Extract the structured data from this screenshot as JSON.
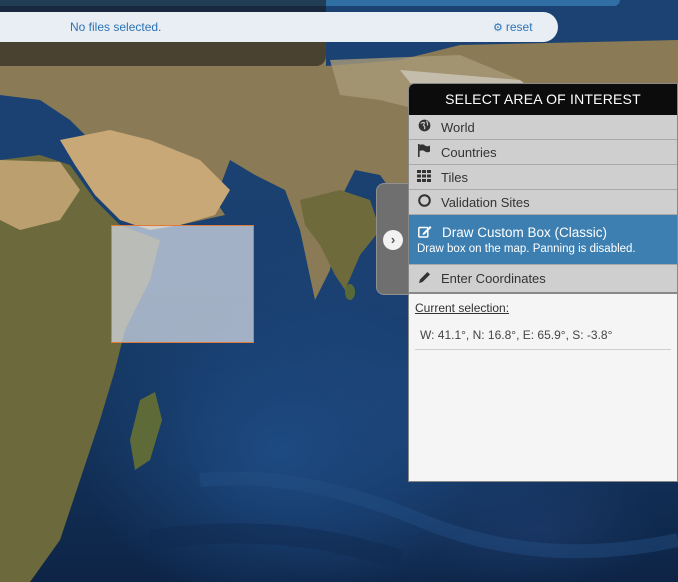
{
  "file_bar": {
    "status": "No files selected.",
    "reset_label": "reset",
    "reset_icon": "gears-icon"
  },
  "panel": {
    "title": "SELECT AREA OF INTEREST",
    "toggle_icon": "chevron-right-circle-icon",
    "items": [
      {
        "label": "World",
        "icon": "globe-icon"
      },
      {
        "label": "Countries",
        "icon": "flag-icon"
      },
      {
        "label": "Tiles",
        "icon": "grid-icon"
      },
      {
        "label": "Validation Sites",
        "icon": "circle-icon"
      },
      {
        "label": "Draw Custom Box (Classic)",
        "icon": "edit-icon",
        "hint": "Draw box on the map. Panning is disabled.",
        "active": true
      },
      {
        "label": "Enter Coordinates",
        "icon": "pencil-icon"
      }
    ],
    "current_selection_title": "Current selection:",
    "current_selection_value": "W: 41.1°, N: 16.8°, E: 65.9°, S: -3.8°"
  },
  "map": {
    "selection_box_color": "#e07a3a",
    "active_color": "#3d7fb0"
  }
}
